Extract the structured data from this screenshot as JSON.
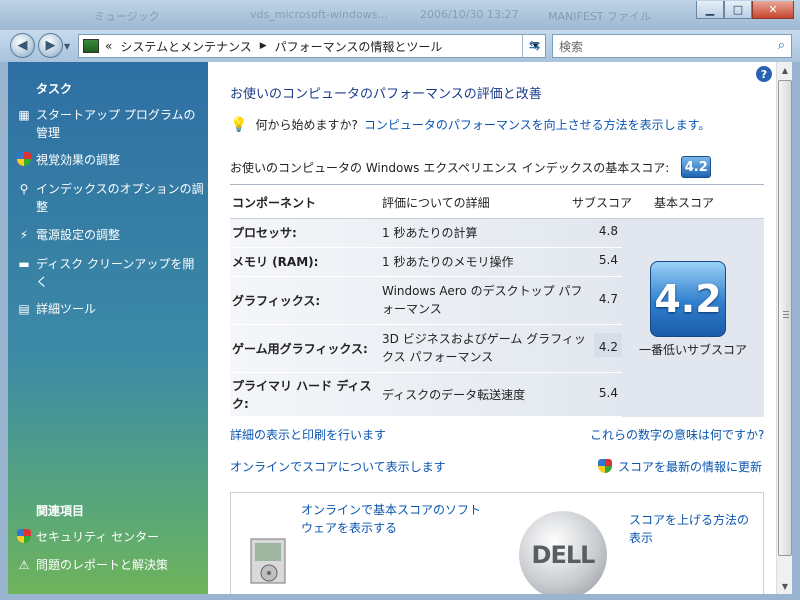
{
  "titlebar": {
    "ghost_texts": [
      "ミュージック",
      "vds_microsoft-windows...",
      "2006/10/30 13:27",
      "MANIFEST ファイル"
    ],
    "buttons": [
      "minimize",
      "maximize",
      "close"
    ]
  },
  "address": {
    "overflow": "«",
    "path": [
      "システムとメンテナンス",
      "パフォーマンスの情報とツール"
    ],
    "search_placeholder": "検索"
  },
  "sidebar": {
    "tasks_heading": "タスク",
    "tasks": [
      {
        "label": "スタートアップ プログラムの管理",
        "icon": "startup-icon"
      },
      {
        "label": "視覚効果の調整",
        "icon": "shield-icon"
      },
      {
        "label": "インデックスのオプションの調整",
        "icon": "indexing-icon"
      },
      {
        "label": "電源設定の調整",
        "icon": "power-icon"
      },
      {
        "label": "ディスク クリーンアップを開く",
        "icon": "disk-cleanup-icon"
      },
      {
        "label": "詳細ツール",
        "icon": "tools-icon"
      }
    ],
    "related_heading": "関連項目",
    "related": [
      {
        "label": "セキュリティ センター",
        "icon": "security-center-icon"
      },
      {
        "label": "問題のレポートと解決策",
        "icon": "problem-reports-icon"
      }
    ]
  },
  "main": {
    "title": "お使いのコンピュータのパフォーマンスの評価と改善",
    "tip_prefix": "何から始めますか?",
    "tip_link": "コンピュータのパフォーマンスを向上させる方法を表示します。",
    "score_label": "お使いのコンピュータの Windows エクスペリエンス インデックスの基本スコア:",
    "score_value": "4.2",
    "table": {
      "headers": [
        "コンポーネント",
        "評価についての詳細",
        "サブスコア",
        "基本スコア"
      ],
      "rows": [
        {
          "component": "プロセッサ:",
          "detail": "1 秒あたりの計算",
          "subscore": "4.8"
        },
        {
          "component": "メモリ (RAM):",
          "detail": "1 秒あたりのメモリ操作",
          "subscore": "5.4"
        },
        {
          "component": "グラフィックス:",
          "detail": "Windows Aero のデスクトップ パフォーマンス",
          "subscore": "4.7"
        },
        {
          "component": "ゲーム用グラフィックス:",
          "detail": "3D ビジネスおよびゲーム グラフィックス パフォーマンス",
          "subscore": "4.2"
        },
        {
          "component": "プライマリ ハード ディスク:",
          "detail": "ディスクのデータ転送速度",
          "subscore": "5.4"
        }
      ],
      "base_score": "4.2",
      "base_caption": "一番低いサブスコア"
    },
    "links": {
      "details_print": "詳細の表示と印刷を行います",
      "what_mean": "これらの数字の意味は何ですか?",
      "online_scores": "オンラインでスコアについて表示します",
      "refresh": "スコアを最新の情報に更新"
    },
    "ads": {
      "software": "オンラインで基本スコアのソフトウェアを表示する",
      "improve": "スコアを上げる方法の表示",
      "logo_text": "DELL"
    }
  }
}
